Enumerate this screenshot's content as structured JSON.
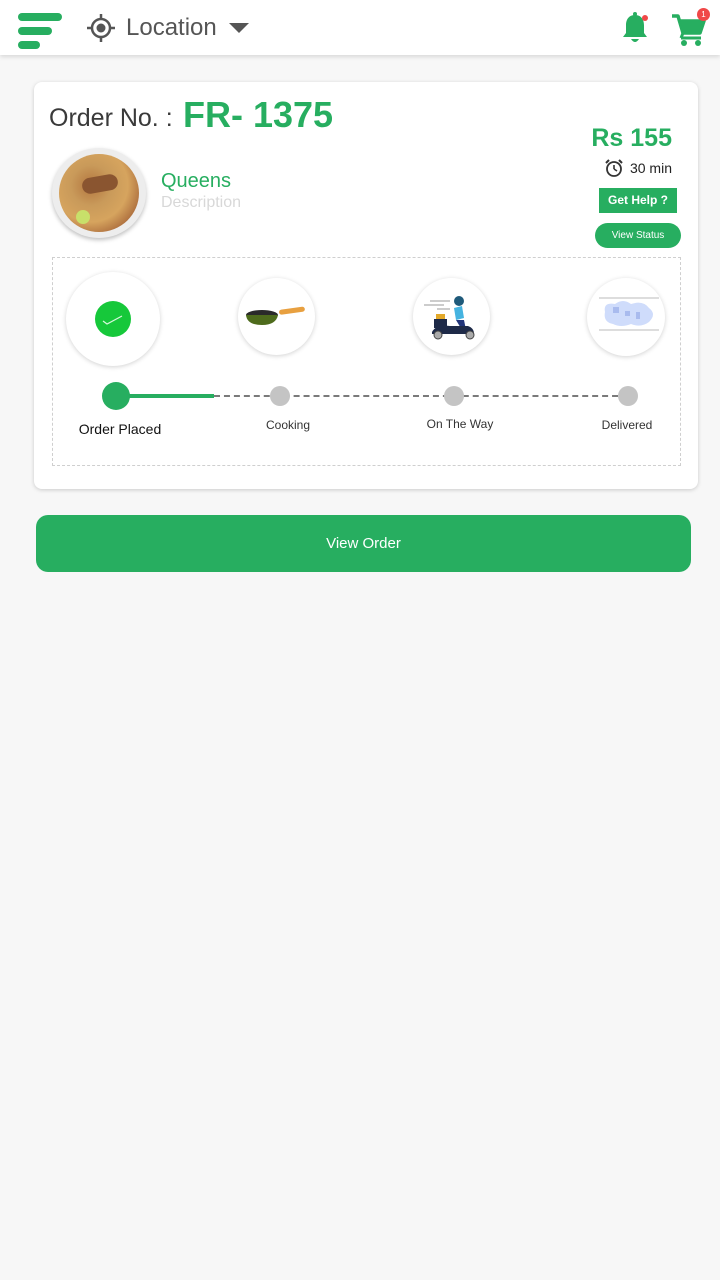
{
  "header": {
    "location_label": "Location",
    "cart_count": "1",
    "icons": {
      "menu": "hamburger-menu-icon",
      "location": "crosshair-location-icon",
      "dropdown": "caret-down-icon",
      "notifications": "bell-icon",
      "cart": "shopping-cart-icon"
    }
  },
  "order": {
    "label": "Order No. :",
    "number": "FR- 1375",
    "restaurant": "Queens",
    "description": "Description",
    "price": "Rs 155",
    "eta": "30 min",
    "get_help_label": "Get Help ?",
    "view_status_label": "View Status"
  },
  "tracker": {
    "current_step": 1,
    "total_steps": 4,
    "steps": [
      {
        "label": "Order Placed",
        "icon": "check-circle-icon",
        "done": true
      },
      {
        "label": "Cooking",
        "icon": "frying-pan-icon",
        "done": false
      },
      {
        "label": "On The Way",
        "icon": "delivery-scooter-icon",
        "done": false
      },
      {
        "label": "Delivered",
        "icon": "delivered-map-icon",
        "done": false
      }
    ]
  },
  "actions": {
    "view_order_label": "View Order"
  },
  "colors": {
    "brand_green": "#27ae60",
    "check_green": "#16c83a",
    "badge_red": "#f04848",
    "pending_gray": "#c4c4c4"
  }
}
